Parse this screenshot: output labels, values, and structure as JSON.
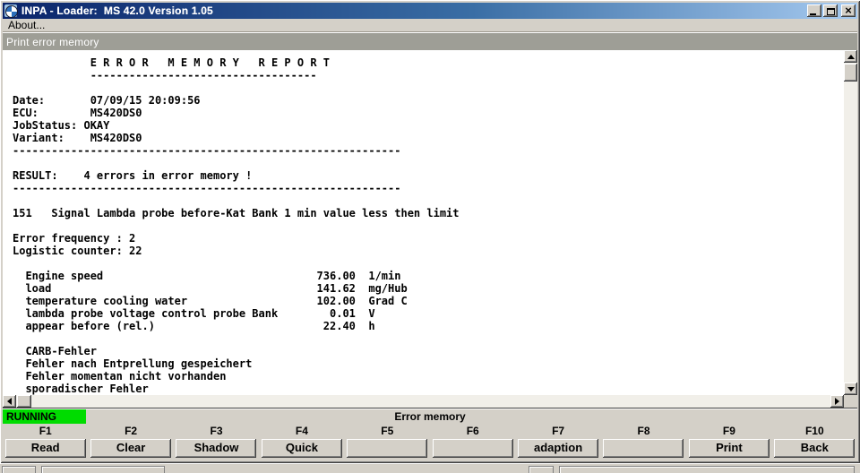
{
  "window": {
    "title": "INPA - Loader:  MS 42.0 Version 1.05",
    "menu_about": "About...",
    "child_title": "Print error memory"
  },
  "report": {
    "text": "            E R R O R   M E M O R Y   R E P O R T\n            -----------------------------------\n\nDate:       07/09/15 20:09:56\nECU:        MS420DS0\nJobStatus: OKAY\nVariant:    MS420DS0\n------------------------------------------------------------\n\nRESULT:    4 errors in error memory !\n------------------------------------------------------------\n\n151   Signal Lambda probe before-Kat Bank 1 min value less then limit\n\nError frequency : 2\nLogistic counter: 22\n\n  Engine speed                                 736.00  1/min\n  load                                         141.62  mg/Hub\n  temperature cooling water                    102.00  Grad C\n  lambda probe voltage control probe Bank        0.01  V\n  appear before (rel.)                          22.40  h\n\n  CARB-Fehler\n  Fehler nach Entprellung gespeichert\n  Fehler momentan nicht vorhanden\n  sporadischer Fehler"
  },
  "status": {
    "state": "RUNNING",
    "screen": "Error memory"
  },
  "fkeys": [
    {
      "key": "F1",
      "label": "Read"
    },
    {
      "key": "F2",
      "label": "Clear"
    },
    {
      "key": "F3",
      "label": "Shadow"
    },
    {
      "key": "F4",
      "label": "Quick"
    },
    {
      "key": "F5",
      "label": ""
    },
    {
      "key": "F6",
      "label": ""
    },
    {
      "key": "F7",
      "label": "adaption"
    },
    {
      "key": "F8",
      "label": ""
    },
    {
      "key": "F9",
      "label": "Print"
    },
    {
      "key": "F10",
      "label": "Back"
    }
  ],
  "colors": {
    "titlebar_start": "#0A246A",
    "titlebar_end": "#A6CAF0",
    "window_face": "#D4D0C8",
    "child_bar": "#9E9E96",
    "running_green": "#00DC00",
    "content_bg": "#FFFFFF",
    "ink": "#000000"
  }
}
